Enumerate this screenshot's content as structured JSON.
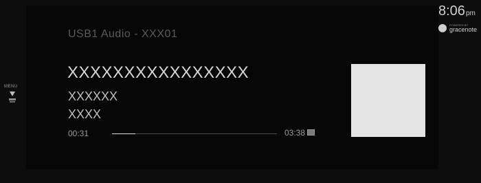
{
  "source_label": "USB1 Audio - XXX01",
  "track": {
    "title": "XXXXXXXXXXXXXXXX",
    "artist": "XXXXXX",
    "album": "XXXX",
    "elapsed": "00:31",
    "total": "03:38",
    "progress_fraction": 0.14
  },
  "side_menu": {
    "label": "MENU"
  },
  "status": {
    "time": "8:06",
    "ampm": "pm",
    "powered_by_small": "POWERED BY",
    "powered_by_brand": "gracenote"
  },
  "colors": {
    "background": "#0b0b0b",
    "text": "#cfcfcf",
    "album_art_placeholder": "#e4e4e4"
  },
  "icons": {
    "menu": "menu-down-arrow-icon",
    "badge": "media-badge-icon",
    "gracenote": "gracenote-logo-icon"
  }
}
